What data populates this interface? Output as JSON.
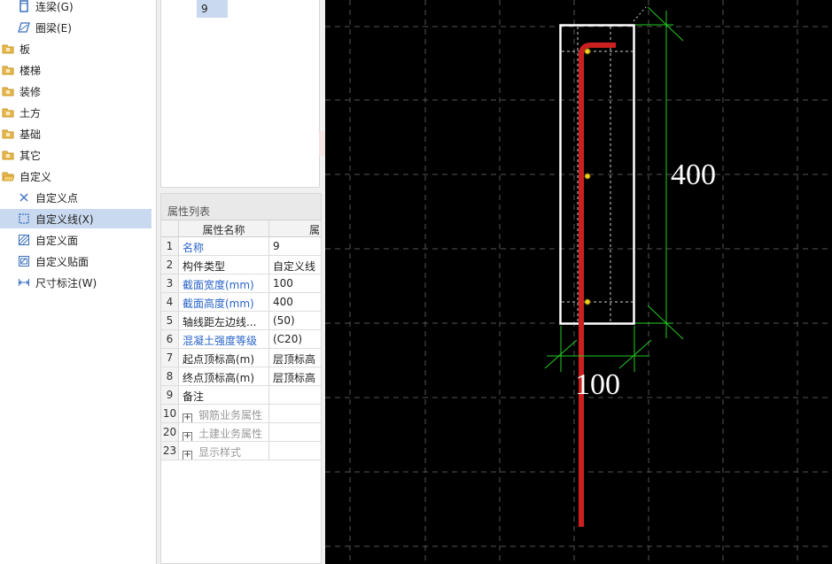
{
  "tree": {
    "items": [
      {
        "label": "连梁(G)",
        "icon": "beam-column-icon",
        "level": 1
      },
      {
        "label": "圈梁(E)",
        "icon": "ring-beam-icon",
        "level": 1
      },
      {
        "label": "板",
        "icon": "folder-icon",
        "level": 0
      },
      {
        "label": "楼梯",
        "icon": "folder-icon",
        "level": 0
      },
      {
        "label": "装修",
        "icon": "folder-icon",
        "level": 0
      },
      {
        "label": "土方",
        "icon": "folder-icon",
        "level": 0
      },
      {
        "label": "基础",
        "icon": "folder-icon",
        "level": 0
      },
      {
        "label": "其它",
        "icon": "folder-icon",
        "level": 0
      },
      {
        "label": "自定义",
        "icon": "folder-open-icon",
        "level": 0
      },
      {
        "label": "自定义点",
        "icon": "custom-point-icon",
        "level": 1
      },
      {
        "label": "自定义线(X)",
        "icon": "custom-line-icon",
        "level": 1,
        "selected": true
      },
      {
        "label": "自定义面",
        "icon": "custom-face-icon",
        "level": 1
      },
      {
        "label": "自定义贴面",
        "icon": "custom-facing-icon",
        "level": 1
      },
      {
        "label": "尺寸标注(W)",
        "icon": "dimension-icon",
        "level": 1
      }
    ]
  },
  "component_list": {
    "selected_value": "9"
  },
  "properties": {
    "title": "属性列表",
    "col_name": "属性名称",
    "col_value": "属",
    "rows": [
      {
        "n": "1",
        "name": "名称",
        "value": "9",
        "style": "blue"
      },
      {
        "n": "2",
        "name": "构件类型",
        "value": "自定义线",
        "style": "normal"
      },
      {
        "n": "3",
        "name": "截面宽度(mm)",
        "value": "100",
        "style": "blue"
      },
      {
        "n": "4",
        "name": "截面高度(mm)",
        "value": "400",
        "style": "blue"
      },
      {
        "n": "5",
        "name": "轴线距左边线...",
        "value": "(50)",
        "style": "normal"
      },
      {
        "n": "6",
        "name": "混凝土强度等级",
        "value": "(C20)",
        "style": "blue"
      },
      {
        "n": "7",
        "name": "起点顶标高(m)",
        "value": "层顶标高",
        "style": "normal"
      },
      {
        "n": "8",
        "name": "终点顶标高(m)",
        "value": "层顶标高",
        "style": "normal"
      },
      {
        "n": "9",
        "name": "备注",
        "value": "",
        "style": "normal"
      },
      {
        "n": "10",
        "name": "钢筋业务属性",
        "value": "",
        "style": "group"
      },
      {
        "n": "20",
        "name": "土建业务属性",
        "value": "",
        "style": "group"
      },
      {
        "n": "23",
        "name": "显示样式",
        "value": "",
        "style": "group"
      }
    ]
  },
  "canvas": {
    "dim_height": "400",
    "dim_width": "100",
    "colors": {
      "background": "#000000",
      "section_outline": "#ffffff",
      "dimension_line": "#22cc22",
      "rebar": "#cc2020",
      "grid": "#555555",
      "point": "#f2d21c"
    }
  }
}
